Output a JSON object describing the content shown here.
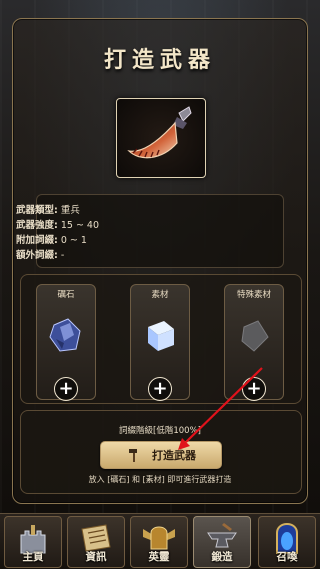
{
  "title": "打造武器",
  "weapon": {
    "icon": "curved-blade-icon"
  },
  "stats": [
    {
      "label": "武器類型:",
      "value": "重兵"
    },
    {
      "label": "武器強度:",
      "value": "15 ~ 40"
    },
    {
      "label": "附加詞綴:",
      "value": "0 ~ 1"
    },
    {
      "label": "額外詞綴:",
      "value": "-"
    }
  ],
  "slots": [
    {
      "label": "礪石",
      "icon": "blue-ore-icon"
    },
    {
      "label": "素材",
      "icon": "crystal-cube-icon"
    },
    {
      "label": "特殊素材",
      "icon": "grey-stone-icon"
    }
  ],
  "craft": {
    "tier_text": "詞綴階級[低階100%]",
    "button_label": "打造武器",
    "hint": "放入 [礪石] 和 [素材] 即可進行武器打造"
  },
  "nav": [
    {
      "label": "主頁",
      "icon": "castle-icon",
      "active": false
    },
    {
      "label": "資訊",
      "icon": "scroll-icon",
      "active": false
    },
    {
      "label": "英靈",
      "icon": "winged-helmet-icon",
      "active": false
    },
    {
      "label": "鍛造",
      "icon": "anvil-icon",
      "active": true
    },
    {
      "label": "召喚",
      "icon": "portal-icon",
      "active": false
    }
  ],
  "colors": {
    "accent": "#c9a96d",
    "border": "#8a7550",
    "arrow": "#e0121b"
  }
}
